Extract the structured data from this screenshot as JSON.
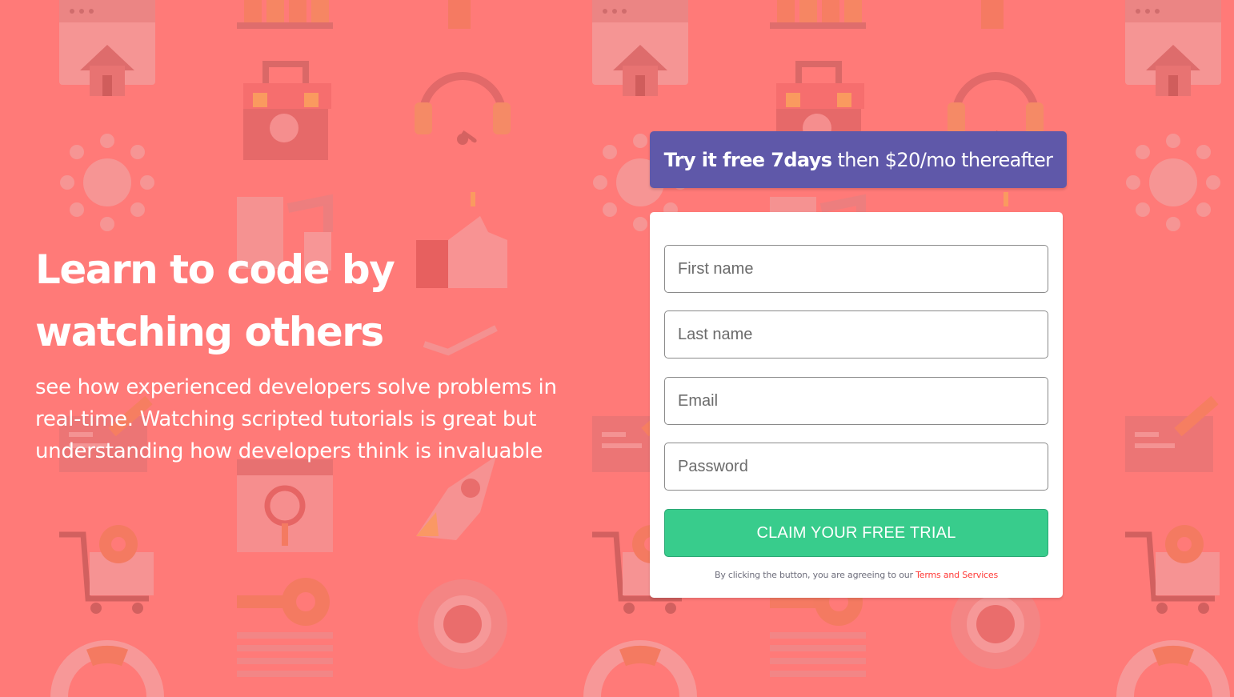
{
  "hero": {
    "title": "Learn to code by watching others",
    "description": "see how experienced developers solve problems in real-time. Watching scripted tutorials is great but understanding how developers think is invaluable"
  },
  "promo": {
    "bold": "Try it free 7days",
    "rest": "then $20/mo thereafter"
  },
  "form": {
    "first_name_placeholder": "First name",
    "last_name_placeholder": "Last name",
    "email_placeholder": "Email",
    "password_placeholder": "Password",
    "submit_label": "CLAIM YOUR FREE TRIAL",
    "terms_prefix": "By clicking the button, you are agreeing to our",
    "terms_link": "Terms and Services"
  },
  "colors": {
    "background": "#ff7a78",
    "promo": "#5f58a9",
    "submit": "#38cc8c",
    "terms_link": "#ff3b38"
  },
  "background_icons": [
    "browser-home-icon",
    "chart-bars-icon",
    "plug-icon",
    "toolbox-icon",
    "headset-icon",
    "network-icon",
    "like-icon",
    "pipeline-icon",
    "rocket-icon",
    "chat-icon",
    "search-icon",
    "cart-gear-icon",
    "key-icon",
    "globe-gear-icon",
    "document-lines-icon",
    "lifebuoy-icon"
  ]
}
